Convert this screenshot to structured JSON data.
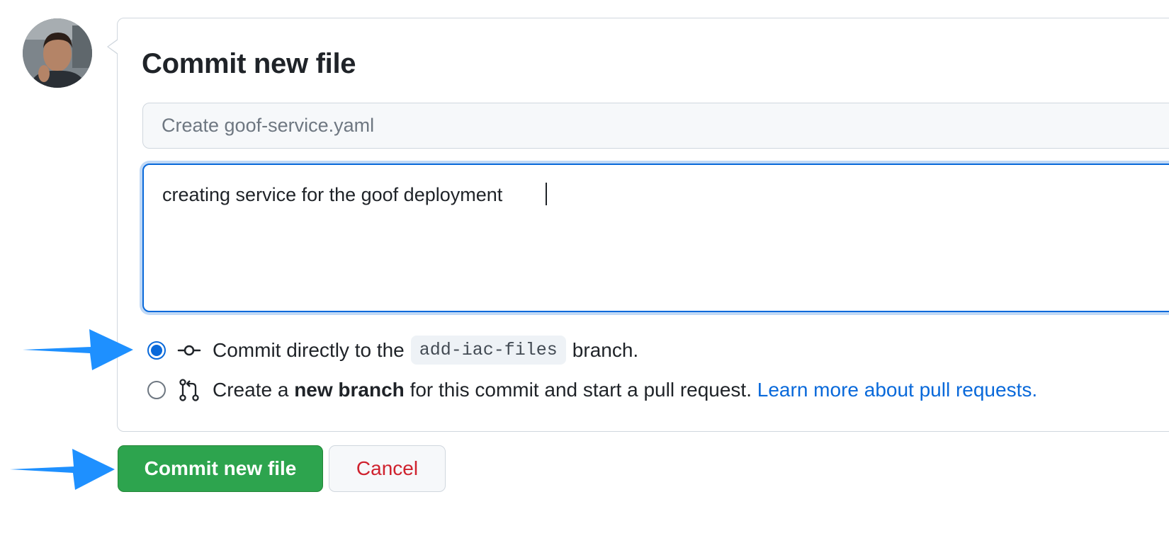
{
  "commit_form": {
    "title": "Commit new file",
    "summary_placeholder": "Create goof-service.yaml",
    "summary_value": "",
    "description_value": "creating service for the goof deployment",
    "options": {
      "direct": {
        "selected": true,
        "prefix": "Commit directly to the",
        "branch": "add-iac-files",
        "suffix": "branch."
      },
      "new_branch": {
        "selected": false,
        "prefix": "Create a",
        "bold": "new branch",
        "middle": "for this commit and start a pull request.",
        "link": "Learn more about pull requests."
      }
    },
    "buttons": {
      "commit_label": "Commit new file",
      "cancel_label": "Cancel"
    }
  },
  "colors": {
    "accent": "#0969da",
    "commit_button": "#2da44e",
    "cancel_text": "#cf222e",
    "annotation_arrow": "#1e90ff"
  },
  "icons": {
    "commit": "git-commit-icon",
    "pull_request": "git-pull-request-icon",
    "annotation": "blue-arrow-icon"
  }
}
